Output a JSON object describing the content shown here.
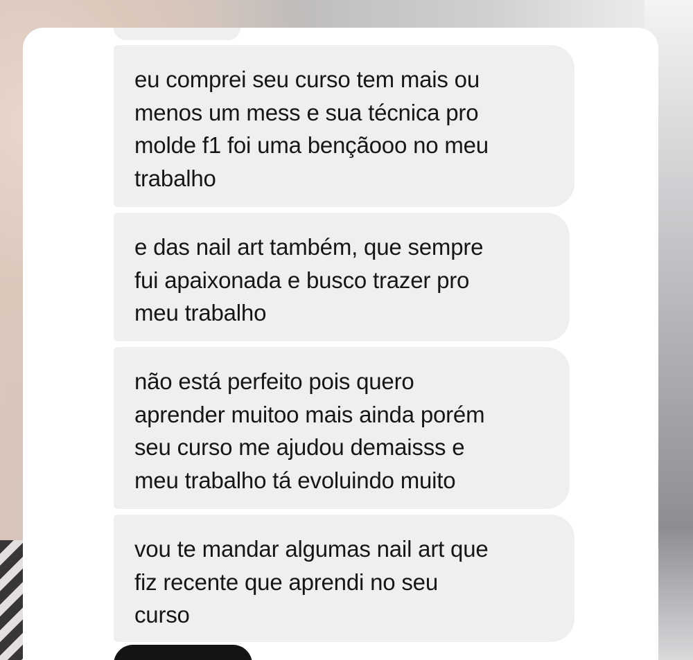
{
  "conversation": {
    "messages": [
      {
        "text": "eu comprei seu curso tem mais ou\nmenos um mess e sua técnica pro\nmolde f1 foi uma bençãooo no meu\ntrabalho"
      },
      {
        "text": "e das nail art também, que sempre\nfui apaixonada e busco trazer pro\nmeu trabalho"
      },
      {
        "text": "não está perfeito pois quero\naprender muitoo mais ainda porém\nseu curso me ajudou demaisss e\nmeu trabalho tá evoluindo muito"
      },
      {
        "text": "vou te mandar algumas nail art que\nfiz recente que aprendi no seu\ncurso"
      }
    ]
  },
  "colors": {
    "bubble_background": "#efefef",
    "card_background": "#ffffff",
    "text": "#161616"
  }
}
